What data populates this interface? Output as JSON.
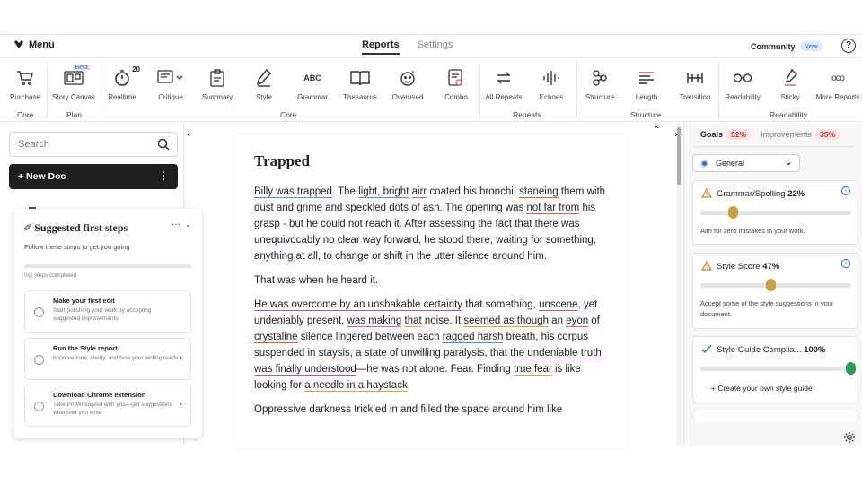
{
  "topbar": {
    "menu_label": "Menu",
    "tabs": [
      {
        "label": "Reports",
        "active": true
      },
      {
        "label": "Settings",
        "active": false
      }
    ],
    "community_label": "Community",
    "new_badge": "New",
    "help_label": "?"
  },
  "toolbar": {
    "tools": [
      {
        "label": "Purchase",
        "icon": "cart-icon"
      },
      {
        "label": "Story Canvas",
        "icon": "story-canvas-icon",
        "badge": "Beta"
      },
      {
        "label": "Realtime",
        "icon": "timer-icon",
        "badge": "20"
      },
      {
        "label": "Critique",
        "icon": "critique-icon"
      },
      {
        "label": "Summary",
        "icon": "clipboard-icon"
      },
      {
        "label": "Style",
        "icon": "pen-icon"
      },
      {
        "label": "Grammar",
        "icon": "abc-icon",
        "glyph": "ABC"
      },
      {
        "label": "Thesaurus",
        "icon": "book-icon"
      },
      {
        "label": "Overused",
        "icon": "face-icon"
      },
      {
        "label": "Combo",
        "icon": "combo-icon"
      },
      {
        "label": "All Repeats",
        "icon": "repeat-icon"
      },
      {
        "label": "Echoes",
        "icon": "soundwave-icon"
      },
      {
        "label": "Structure",
        "icon": "structure-icon"
      },
      {
        "label": "Length",
        "icon": "length-icon"
      },
      {
        "label": "Transition",
        "icon": "transition-icon"
      },
      {
        "label": "Readability",
        "icon": "glasses-icon"
      },
      {
        "label": "Sticky",
        "icon": "sticky-icon"
      },
      {
        "label": "More Reports",
        "icon": "more-icon",
        "glyph": "ooo"
      }
    ],
    "groups": [
      {
        "label": "Core"
      },
      {
        "label": "Plan"
      },
      {
        "label": "Core"
      },
      {
        "label": "Repeats"
      },
      {
        "label": "Structure"
      },
      {
        "label": "Readability"
      }
    ]
  },
  "left": {
    "search_placeholder": "Search",
    "new_doc_label": "+ New Doc",
    "steps": {
      "title": "Suggested first steps",
      "subtitle": "Follow these steps to get you going",
      "progress_text": "0/3 steps completed",
      "progress": 0,
      "items": [
        {
          "title": "Make your first edit",
          "desc": "Start polishing your work by accepting suggested improvements"
        },
        {
          "title": "Run the Style report",
          "desc": "Improve tone, clarity, and how your writing reads"
        },
        {
          "title": "Download Chrome extension",
          "desc": "Take ProWritingAid with you—get suggestions wherever you write"
        }
      ]
    }
  },
  "doc": {
    "title": "Trapped",
    "p1": [
      {
        "t": "Billy was trapped",
        "u": "b"
      },
      {
        "t": ". The "
      },
      {
        "t": "light, bright",
        "u": "b"
      },
      {
        "t": " "
      },
      {
        "t": "airr",
        "u": "r"
      },
      {
        "t": " coated his bronchi, "
      },
      {
        "t": "staneing",
        "u": "r"
      },
      {
        "t": " them with dust and grime and speckled dots of ash. The opening was "
      },
      {
        "t": "not far from",
        "u": "r"
      },
      {
        "t": " his grasp - but he could not reach it. "
      },
      {
        "t": " ",
        "u": "b"
      },
      {
        "t": " After assessing the fact that there was "
      },
      {
        "t": "unequivocably",
        "u": "b"
      },
      {
        "t": " no "
      },
      {
        "t": "clear way",
        "u": "b"
      },
      {
        "t": " forward, he stood there, waiting for something, anything at all, to change or shift in the utter silence around him."
      }
    ],
    "p2": [
      {
        "t": "That was when he heard it."
      }
    ],
    "p3": [
      {
        "t": "He was overcome by an unshakable certainty",
        "u": "p"
      },
      {
        "t": " that something, "
      },
      {
        "t": "unscene",
        "u": "r"
      },
      {
        "t": ", yet undeniably present, "
      },
      {
        "t": "was making",
        "u": "p"
      },
      {
        "t": " "
      },
      {
        "t": "that",
        "u": "o"
      },
      {
        "t": " noise. It "
      },
      {
        "t": "seemed as though",
        "u": "o"
      },
      {
        "t": " an "
      },
      {
        "t": "eyon",
        "u": "r"
      },
      {
        "t": " of "
      },
      {
        "t": "crystaline",
        "u": "r"
      },
      {
        "t": " silence lingered between each "
      },
      {
        "t": "ragged harsh",
        "u": "b"
      },
      {
        "t": " breath, his corpus suspended in "
      },
      {
        "t": "staysis",
        "u": "r"
      },
      {
        "t": ", a state of unwilling paralysis, that "
      },
      {
        "t": "the undeniable truth was finally understood",
        "u": "p"
      },
      {
        "t": "—he was not alone. Fear. Finding "
      },
      {
        "t": "true fear",
        "u": "o"
      },
      {
        "t": " is like looking for "
      },
      {
        "t": "a needle in a haystack",
        "u": "o"
      },
      {
        "t": "."
      }
    ],
    "p4": [
      {
        "t": "Oppressive darkness trickled in and filled the space around him like"
      }
    ]
  },
  "right": {
    "goals_label": "Goals",
    "goals_pct": "52%",
    "improvements_label": "Improvements",
    "improvements_pct": "35%",
    "general_label": "General",
    "cards": [
      {
        "name": "Grammar/Spelling",
        "score": "22%",
        "value": 0.22,
        "desc": "Aim for zero mistakes in your work.",
        "status": "warning"
      },
      {
        "name": "Style Score",
        "score": "47%",
        "value": 0.47,
        "desc": "Accept some of the style suggestions in your document.",
        "status": "warning"
      },
      {
        "name": "Style Guide Complia...",
        "score": "100%",
        "value": 1.0,
        "status": "ok",
        "action": "+ Create your own style guide"
      }
    ]
  },
  "colors": {
    "accent_blue": "#2d6ad8",
    "warn_gold": "#c9a040",
    "ok_green": "#2e9b55",
    "pill_red": "#fde2e2",
    "new_doc_bg": "#1e1e1e"
  }
}
